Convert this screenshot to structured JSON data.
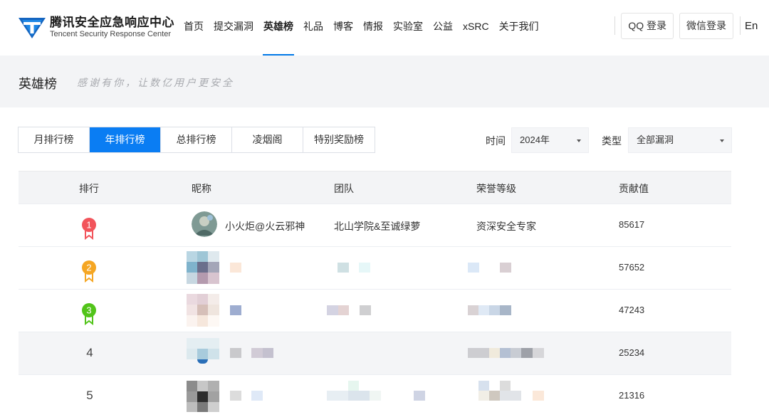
{
  "header": {
    "logo_cn": "腾讯安全应急响应中心",
    "logo_en": "Tencent Security Response Center",
    "nav": [
      {
        "label": "首页"
      },
      {
        "label": "提交漏洞"
      },
      {
        "label": "英雄榜"
      },
      {
        "label": "礼品"
      },
      {
        "label": "博客"
      },
      {
        "label": "情报"
      },
      {
        "label": "实验室"
      },
      {
        "label": "公益"
      },
      {
        "label": "xSRC"
      },
      {
        "label": "关于我们"
      }
    ],
    "active_nav": "英雄榜",
    "qq_login": "QQ 登录",
    "wechat_login": "微信登录",
    "lang": "En"
  },
  "banner": {
    "title": "英雄榜",
    "subtitle": "感谢有你，让数亿用户更安全"
  },
  "tabs": [
    {
      "label": "月排行榜"
    },
    {
      "label": "年排行榜"
    },
    {
      "label": "总排行榜"
    },
    {
      "label": "凌烟阁"
    },
    {
      "label": "特别奖励榜"
    }
  ],
  "active_tab": "年排行榜",
  "filters": {
    "time_label": "时间",
    "time_value": "2024年",
    "type_label": "类型",
    "type_value": "全部漏洞"
  },
  "table": {
    "columns": [
      "排行",
      "昵称",
      "团队",
      "荣誉等级",
      "贡献值"
    ],
    "rows": [
      {
        "rank": "1",
        "nickname": "小火炬@火云邪神",
        "team": "北山学院&至诚绿萝",
        "level": "资深安全专家",
        "score": "85617"
      },
      {
        "rank": "2",
        "nickname": "",
        "team": "",
        "level": "",
        "score": "57652"
      },
      {
        "rank": "3",
        "nickname": "",
        "team": "",
        "level": "",
        "score": "47243"
      },
      {
        "rank": "4",
        "nickname": "",
        "team": "",
        "level": "",
        "score": "25234"
      },
      {
        "rank": "5",
        "nickname": "",
        "team": "",
        "level": "",
        "score": "21316"
      }
    ]
  },
  "colors": {
    "accent": "#0a7df3",
    "medal_gold": "#f2545b",
    "medal_silver": "#f5a623",
    "medal_bronze": "#52c41a"
  }
}
